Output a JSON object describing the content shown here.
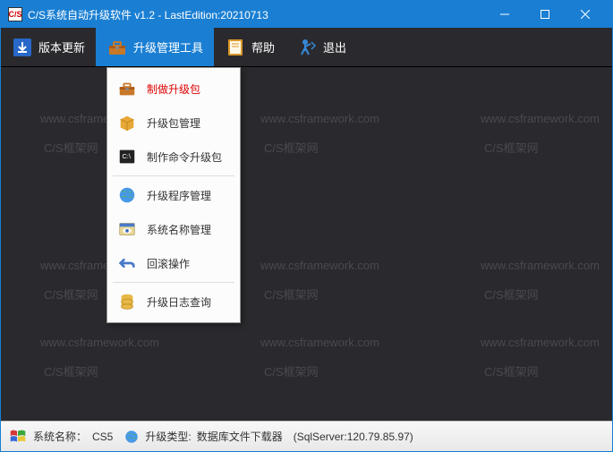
{
  "titlebar": {
    "icon_text": "C/S",
    "title": "C/S系统自动升级软件 v1.2 - LastEdition:20210713"
  },
  "toolbar": {
    "items": [
      {
        "label": "版本更新"
      },
      {
        "label": "升级管理工具"
      },
      {
        "label": "帮助"
      },
      {
        "label": "退出"
      }
    ]
  },
  "dropdown": {
    "items": [
      {
        "label": "制做升级包"
      },
      {
        "label": "升级包管理"
      },
      {
        "label": "制作命令升级包"
      },
      {
        "label": "升级程序管理"
      },
      {
        "label": "系统名称管理"
      },
      {
        "label": "回滚操作"
      },
      {
        "label": "升级日志查询"
      }
    ]
  },
  "watermark": {
    "url": "www.csframework.com",
    "sub": "C/S框架网"
  },
  "statusbar": {
    "label_system": "系统名称：",
    "system_name": "CS5",
    "label_type": "升级类型:",
    "type_value": "数据库文件下载器",
    "server": "(SqlServer:120.79.85.97)"
  },
  "colors": {
    "accent": "#1a7fd3",
    "toolbar_bg": "#2a2a2e",
    "menu_highlight": "#d00"
  }
}
